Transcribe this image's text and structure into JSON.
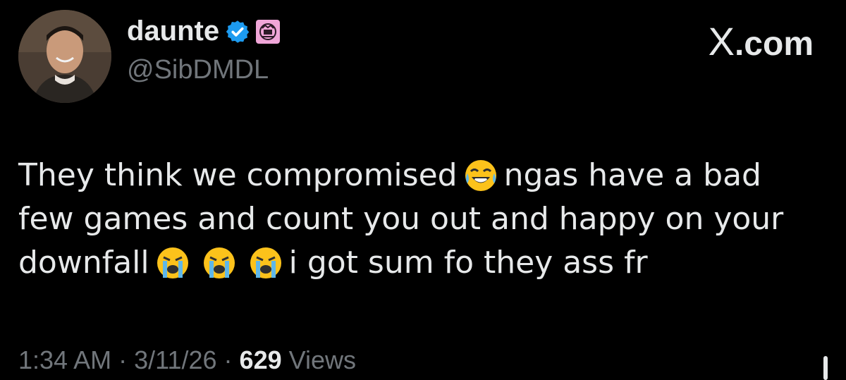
{
  "header": {
    "display_name": "daunte",
    "handle": "@SibDMDL",
    "brand": "X.com",
    "brand_x": "X",
    "brand_suffix": ".com"
  },
  "tweet": {
    "lines": [
      [
        "They think we compromised",
        "ngas have a bad"
      ],
      [
        "few games and count you out and happy on your"
      ],
      [
        "downfall",
        "i got sum fo they ass fr"
      ]
    ],
    "line1_a": "They think we compromised",
    "line1_b": "ngas have a bad",
    "line2": "few games and count you out and happy on your",
    "line3_a": "downfall",
    "line3_b": "i got sum fo they ass fr",
    "emojis": [
      "face-with-tears-of-joy",
      "loudly-crying-face",
      "loudly-crying-face",
      "loudly-crying-face"
    ]
  },
  "meta": {
    "time": "1:34 AM",
    "sep1": "·",
    "date": "3/11/26",
    "sep2": "·",
    "views_count": "629",
    "views_label": "Views"
  },
  "colors": {
    "background": "#000000",
    "text": "#e7e9ea",
    "muted": "#71767b",
    "verified": "#1d9bf0",
    "affiliate_badge": "#f0a6d8"
  }
}
